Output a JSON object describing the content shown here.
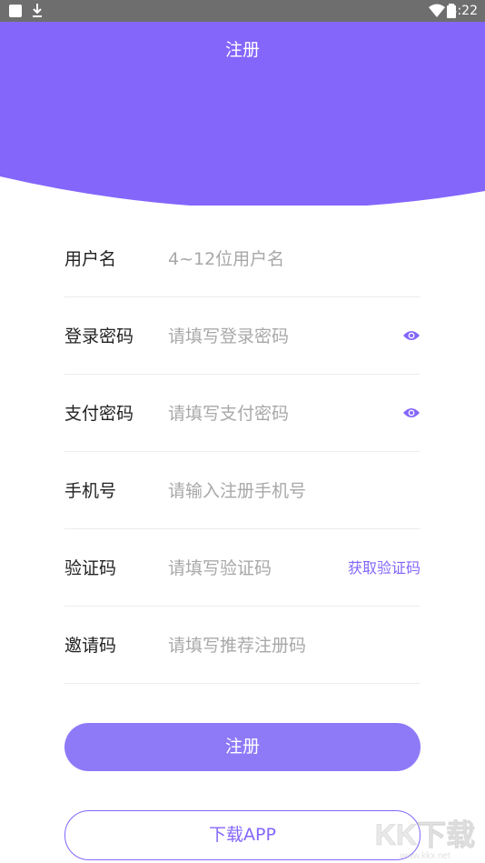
{
  "status_bar": {
    "time": "4:22"
  },
  "header": {
    "title": "注册"
  },
  "colors": {
    "accent": "#8466fb",
    "button": "#8e7af7"
  },
  "form": {
    "fields": [
      {
        "label": "用户名",
        "placeholder": "4~12位用户名"
      },
      {
        "label": "登录密码",
        "placeholder": "请填写登录密码",
        "icon": "eye-icon"
      },
      {
        "label": "支付密码",
        "placeholder": "请填写支付密码",
        "icon": "eye-icon"
      },
      {
        "label": "手机号",
        "placeholder": "请输入注册手机号"
      },
      {
        "label": "验证码",
        "placeholder": "请填写验证码",
        "action": "获取验证码"
      },
      {
        "label": "邀请码",
        "placeholder": "请填写推荐注册码"
      }
    ]
  },
  "buttons": {
    "register": "注册",
    "download": "下载APP"
  },
  "watermark": {
    "text": "KK下载",
    "url": "www.kkx.net"
  }
}
